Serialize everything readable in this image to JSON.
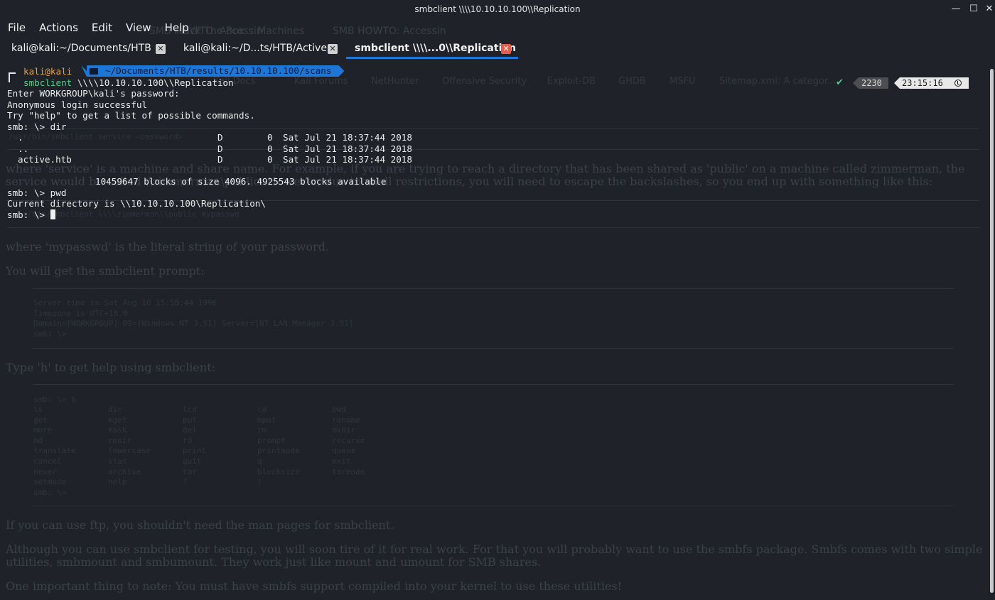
{
  "window": {
    "title": "smbclient \\\\\\\\10.10.10.100\\\\Replication",
    "minimize_glyph": "—",
    "maximize_glyph": "☐",
    "close_glyph": "✕"
  },
  "menu": [
    "File",
    "Actions",
    "Edit",
    "View",
    "Help"
  ],
  "tabs": [
    {
      "label": "kali@kali:~/Documents/HTB",
      "active": false
    },
    {
      "label": "kali@kali:~/D...ts/HTB/Active",
      "active": false
    },
    {
      "label": "smbclient \\\\\\\\...0\\\\Replication",
      "active": true
    }
  ],
  "tab_close_glyph": "✕",
  "colors": {
    "accent": "#1e76d6",
    "tab_close": "#e65c4a",
    "inactive_close": "#d0d0d0",
    "prompt_user": "#e0a24a",
    "command": "#4fd18a"
  },
  "prompt": {
    "user": "kali@kali",
    "path": "~/Documents/HTB/results/10.10.10.100/scans",
    "command_name": "smbclient",
    "command_args": " \\\\\\\\10.10.10.100\\\\Replication",
    "status_check": "✔",
    "history_count": "2230",
    "time": "23:15:16"
  },
  "terminal": {
    "lines_before": [
      "Enter WORKGROUP\\kali's password:",
      "Anonymous login successful",
      "Try \"help\" to get a list of possible commands.",
      "smb: \\> dir"
    ],
    "dir_rows": [
      {
        "name": ".",
        "attr": "D",
        "size": "0",
        "date": "Sat Jul 21 18:37:44 2018"
      },
      {
        "name": "..",
        "attr": "D",
        "size": "0",
        "date": "Sat Jul 21 18:37:44 2018"
      },
      {
        "name": "active.htb",
        "attr": "D",
        "size": "0",
        "date": "Sat Jul 21 18:37:44 2018"
      }
    ],
    "blocks_line": "10459647 blocks of size 4096. 4925543 blocks available",
    "pwd_cmd": "smb: \\> pwd",
    "pwd_result": "Current directory is \\\\10.10.10.100\\Replication\\",
    "current_prompt": "smb: \\> "
  },
  "background": {
    "tabs": [
      "SMB HOWTO: Accessin",
      "Hack The Box :: Machines",
      "SMB HOWTO: Accessin"
    ],
    "bookmarks": [
      "Kali Docs",
      "Kali Forums",
      "NetHunter",
      "Offensive Security",
      "Exploit-DB",
      "GHDB",
      "MSFU",
      "Sitemap.xml: A categor..."
    ],
    "code_line_1": "/usr/bin/smbclient service <password>",
    "para_1a": "where 'service' is a machine and share name. For example, if you are trying to reach a directory that has been shared as 'public' on a machine called zimmerman, the",
    "para_1b": "service would be called \\\\zimmerman\\public. However, due to shell restrictions, you will need to escape the backslashes, so you end up with something like this:",
    "code_line_2": "/usr/bin/smbclient \\\\\\\\zimmerman\\\\public mypasswd",
    "para_2": "where 'mypasswd' is the literal string of your password.",
    "para_3": "You will get the smbclient prompt:",
    "prompt_block": [
      "Server time is Sat Aug 10 15:58:44 1996",
      "Timezone is UTC+10.0",
      "Domain=[WORKGROUP] OS=[Windows NT 3.51] Server=[NT LAN Manager 3.51]",
      "smb: \\>"
    ],
    "para_4": "Type 'h' to get help using smbclient:",
    "help_first": "smb: \\> h",
    "help_rows": [
      [
        "ls",
        "dir",
        "lcd",
        "cd",
        "pwd"
      ],
      [
        "get",
        "mget",
        "put",
        "mput",
        "rename"
      ],
      [
        "more",
        "mask",
        "del",
        "rm",
        "mkdir"
      ],
      [
        "md",
        "rmdir",
        "rd",
        "prompt",
        "recurse"
      ],
      [
        "translate",
        "lowercase",
        "print",
        "printmode",
        "queue"
      ],
      [
        "cancel",
        "stat",
        "quit",
        "q",
        "exit"
      ],
      [
        "newer",
        "archive",
        "tar",
        "blocksize",
        "tarmode"
      ],
      [
        "setmode",
        "help",
        "?",
        "!",
        ""
      ]
    ],
    "help_last": "smb: \\>",
    "para_5": "If you can use ftp, you shouldn't need the man pages for smbclient.",
    "para_6a": "Although you can use smbclient for testing, you will soon tire of it for real work. For that you will probably want to use the smbfs package. Smbfs comes with two simple",
    "para_6b": "utilities, smbmount and smbumount. They work just like mount and umount for SMB shares.",
    "para_7": "One important thing to note: You must have smbfs support compiled into your kernel to use these utilities!"
  }
}
